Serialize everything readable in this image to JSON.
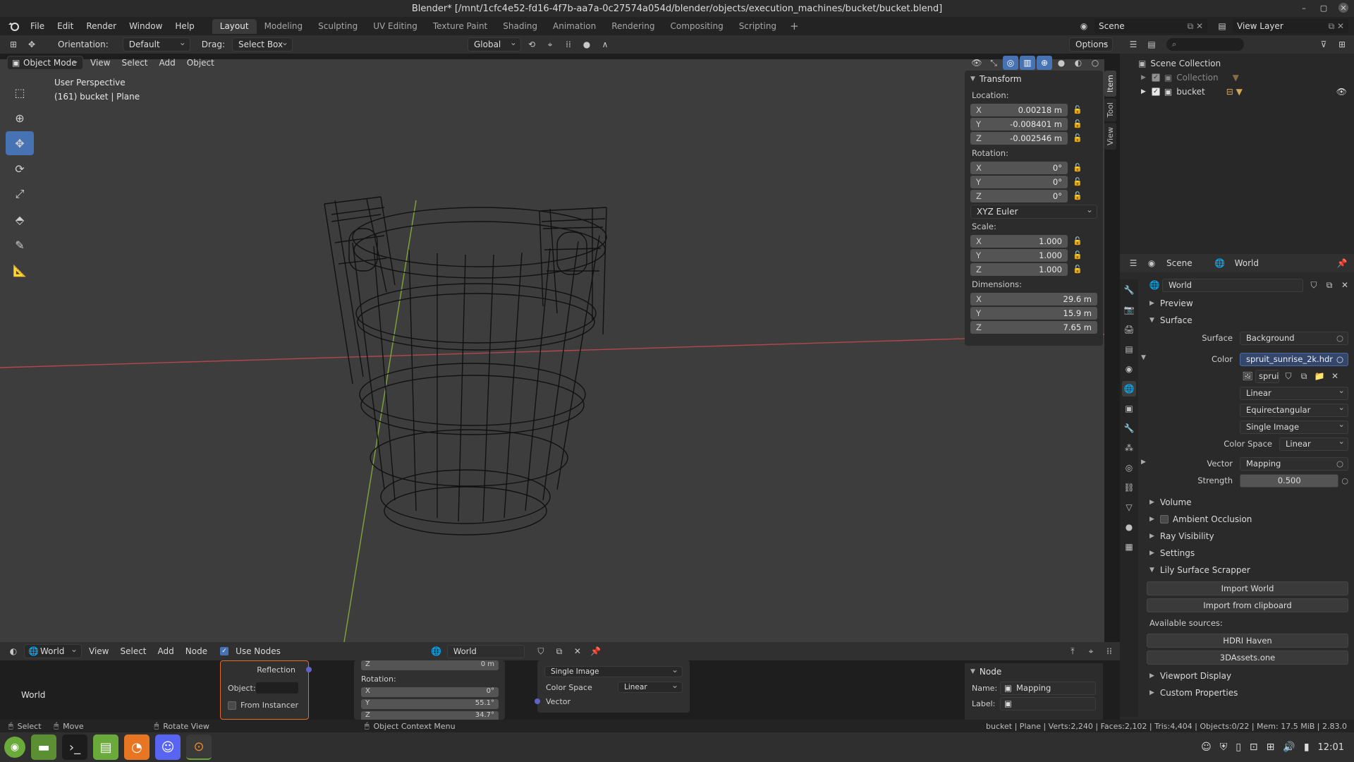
{
  "window": {
    "title": "Blender* [/mnt/1cfc4e52-fd16-4f7b-aa7a-0c27574a054d/blender/objects/execution_machines/bucket/bucket.blend]"
  },
  "menu": [
    "File",
    "Edit",
    "Render",
    "Window",
    "Help"
  ],
  "workspaces": [
    "Layout",
    "Modeling",
    "Sculpting",
    "UV Editing",
    "Texture Paint",
    "Shading",
    "Animation",
    "Rendering",
    "Compositing",
    "Scripting"
  ],
  "active_workspace": "Layout",
  "scene_name": "Scene",
  "view_layer": "View Layer",
  "tool_header": {
    "orientation_label": "Orientation:",
    "orientation_value": "Default",
    "drag_label": "Drag:",
    "drag_value": "Select Box",
    "transform_space": "Global",
    "options": "Options"
  },
  "viewport_header": {
    "mode": "Object Mode",
    "items": [
      "View",
      "Select",
      "Add",
      "Object"
    ]
  },
  "viewport": {
    "perspective": "User Perspective",
    "object_info": "(161) bucket | Plane"
  },
  "n_panel": {
    "tabs": [
      "Item",
      "Tool",
      "View"
    ],
    "title": "Transform",
    "location_label": "Location:",
    "location": [
      {
        "axis": "X",
        "value": "0.00218 m"
      },
      {
        "axis": "Y",
        "value": "-0.008401 m"
      },
      {
        "axis": "Z",
        "value": "-0.002546 m"
      }
    ],
    "rotation_label": "Rotation:",
    "rotation": [
      {
        "axis": "X",
        "value": "0°"
      },
      {
        "axis": "Y",
        "value": "0°"
      },
      {
        "axis": "Z",
        "value": "0°"
      }
    ],
    "rotation_mode": "XYZ Euler",
    "scale_label": "Scale:",
    "scale": [
      {
        "axis": "X",
        "value": "1.000"
      },
      {
        "axis": "Y",
        "value": "1.000"
      },
      {
        "axis": "Z",
        "value": "1.000"
      }
    ],
    "dimensions_label": "Dimensions:",
    "dimensions": [
      {
        "axis": "X",
        "value": "29.6 m"
      },
      {
        "axis": "Y",
        "value": "15.9 m"
      },
      {
        "axis": "Z",
        "value": "7.65 m"
      }
    ]
  },
  "outliner": {
    "root": "Scene Collection",
    "items": [
      {
        "name": "Collection",
        "enabled": true
      },
      {
        "name": "bucket",
        "enabled": true
      }
    ]
  },
  "properties": {
    "breadcrumb_scene": "Scene",
    "breadcrumb_world": "World",
    "world_name": "World",
    "sections": {
      "preview": "Preview",
      "surface": "Surface",
      "volume": "Volume",
      "ambient_occlusion": "Ambient Occlusion",
      "ray_visibility": "Ray Visibility",
      "settings": "Settings",
      "lily": "Lily Surface Scrapper",
      "viewport_display": "Viewport Display",
      "custom_properties": "Custom Properties"
    },
    "surface_label": "Surface",
    "surface_value": "Background",
    "color_label": "Color",
    "color_value": "spruit_sunrise_2k.hdr",
    "image_name": "sprui",
    "interpolation": "Linear",
    "projection": "Equirectangular",
    "source": "Single Image",
    "color_space_label": "Color Space",
    "color_space_value": "Linear",
    "vector_label": "Vector",
    "vector_value": "Mapping",
    "strength_label": "Strength",
    "strength_value": "0.500",
    "import_world": "Import World",
    "import_clipboard": "Import from clipboard",
    "available_sources": "Available sources:",
    "source_hdri": "HDRI Haven",
    "source_3dassets": "3DAssets.one"
  },
  "node_editor": {
    "editor": "World",
    "items": [
      "View",
      "Select",
      "Add",
      "Node"
    ],
    "use_nodes": "Use Nodes",
    "world_field": "World",
    "world_label": "World",
    "reflection": "Reflection",
    "object_label": "Object:",
    "from_instancer": "From Instancer",
    "mapping_z_top": "0 m",
    "mapping_rotation_label": "Rotation:",
    "mapping_rotation": [
      {
        "axis": "X",
        "value": "0°"
      },
      {
        "axis": "Y",
        "value": "55.1°"
      },
      {
        "axis": "Z",
        "value": "34.7°"
      }
    ],
    "image_source": "Single Image",
    "image_color_space_label": "Color Space",
    "image_color_space": "Linear",
    "image_vector": "Vector",
    "node_panel_title": "Node",
    "node_name_label": "Name:",
    "node_name_value": "Mapping",
    "node_label_label": "Label:"
  },
  "statusbar": {
    "select": "Select",
    "move": "Move",
    "rotate": "Rotate View",
    "context": "Object Context Menu",
    "stats": "bucket | Plane | Verts:2,240 | Faces:2,102 | Tris:4,404 | Objects:0/22 | Mem: 17.5 MiB | 2.83.0"
  },
  "taskbar": {
    "clock": "12:01"
  },
  "colors": {
    "accent": "#4772b3",
    "x_axis": "#b4474d",
    "y_axis": "#7fa63a"
  }
}
